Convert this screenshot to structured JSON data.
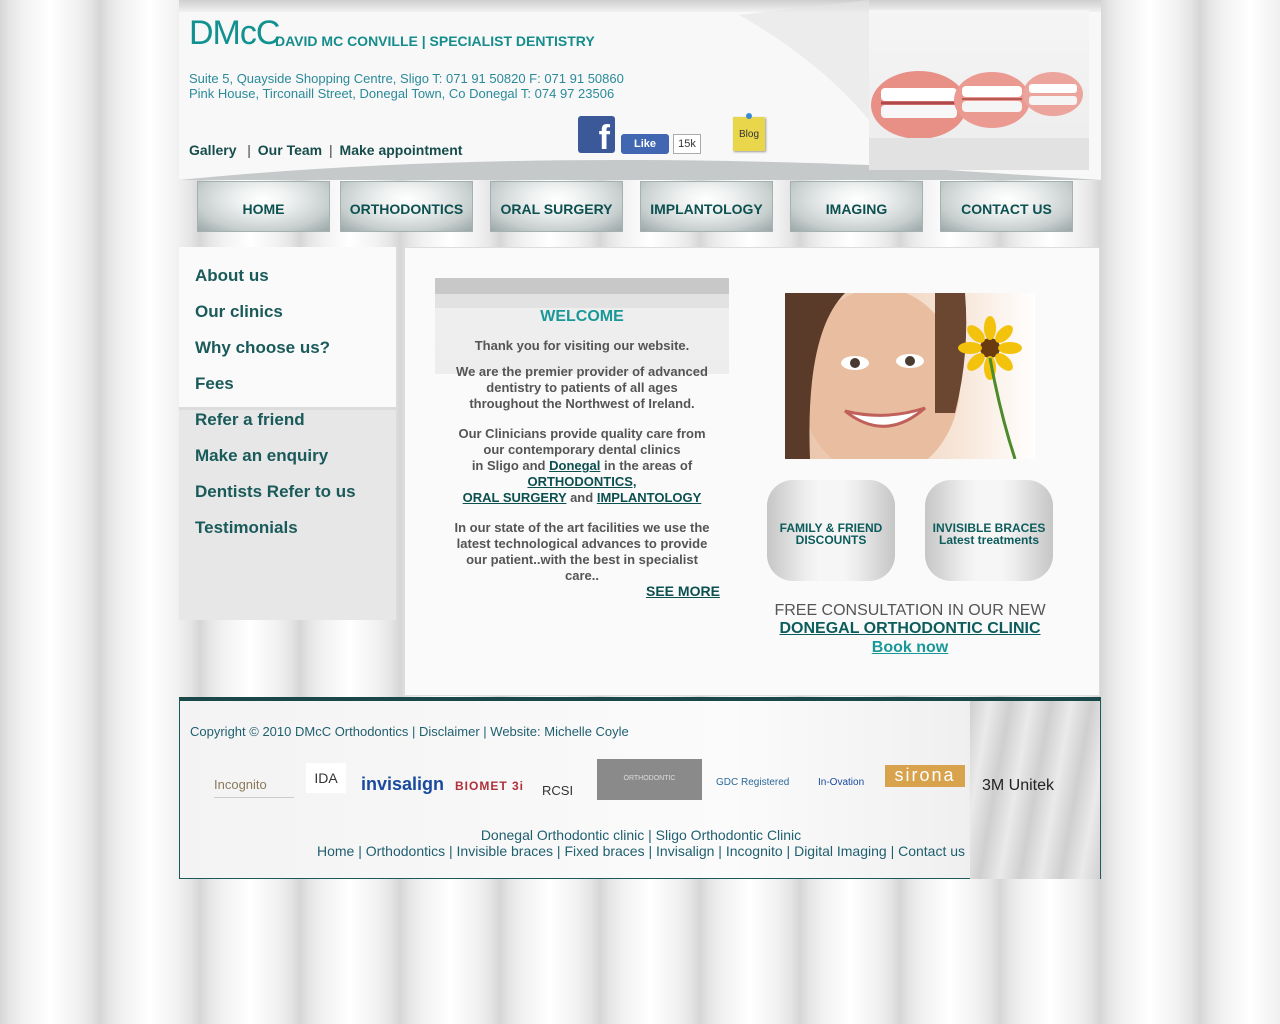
{
  "header": {
    "logo": "DMcC",
    "tagline": "DAVID MC CONVILLE | SPECIALIST DENTISTRY",
    "address_line1": "Suite 5, Quayside Shopping Centre, Sligo T: 071 91 50820 F: 071 91 50860",
    "address_line2": "Pink House, Tirconaill Street, Donegal Town, Co Donegal T: 074 97 23506",
    "links": [
      "Gallery",
      "Our Team",
      "Make appointment"
    ],
    "fb_like": "Like",
    "fb_count": "15k",
    "blog": "Blog"
  },
  "nav": [
    "HOME",
    "ORTHODONTICS",
    "ORAL SURGERY",
    "IMPLANTOLOGY",
    "IMAGING",
    "CONTACT US"
  ],
  "sidebar": {
    "items": [
      "About us",
      "Our clinics",
      "Why choose us?",
      "Fees",
      "Refer a friend",
      "Make an enquiry",
      "Dentists Refer to us",
      "Testimonials"
    ]
  },
  "welcome": {
    "title": "WELCOME",
    "p1": "Thank you for visiting our website.",
    "p2_l1": "We are the premier provider of advanced",
    "p2_l2": "dentistry to patients of all ages",
    "p2_l3": "throughout the Northwest of Ireland.",
    "p3_l1": "Our Clinicians provide quality care from",
    "p3_l2": "our contemporary dental clinics",
    "p3_l3a": "in Sligo and",
    "p3_l3link": "Donegal",
    "p3_l3b": "in the areas of",
    "p3_link_ortho": "ORTHODONTICS,",
    "p3_link_oral": "ORAL SURGERY",
    "p3_and": "and",
    "p3_link_impl": "IMPLANTOLOGY",
    "p4_l1": "In our state of the art facilities we use the",
    "p4_l2": "latest technological advances to provide",
    "p4_l3": "our patient..with the best in specialist",
    "p4_l4": "care..",
    "see_more": "SEE MORE"
  },
  "promos": [
    {
      "line1": "FAMILY & FRIEND",
      "line2": "DISCOUNTS"
    },
    {
      "line1": "INVISIBLE BRACES",
      "line2": "Latest treatments"
    }
  ],
  "consultation": {
    "line1": "FREE CONSULTATION IN OUR NEW",
    "line2": "DONEGAL ORTHODONTIC CLINIC",
    "line3": "Book now"
  },
  "footer": {
    "copyright": "Copyright © 2010 DMcC Orthodontics",
    "disclaimer": "Disclaimer",
    "website": "Website: Michelle Coyle",
    "logos": [
      "Incognito",
      "IDA",
      "invisalign",
      "BIOMET 3i",
      "RCSI",
      "ORTHODONTIC",
      "GDC Registered",
      "In-Ovation",
      "sirona",
      "3M Unitek"
    ],
    "clinic_links": [
      "Donegal Orthodontic clinic",
      "Sligo Orthodontic Clinic"
    ],
    "links": [
      "Home",
      "Orthodontics",
      "Invisible braces",
      "Fixed braces",
      "Invisalign",
      "Incognito",
      "Digital Imaging",
      "Contact us"
    ]
  }
}
